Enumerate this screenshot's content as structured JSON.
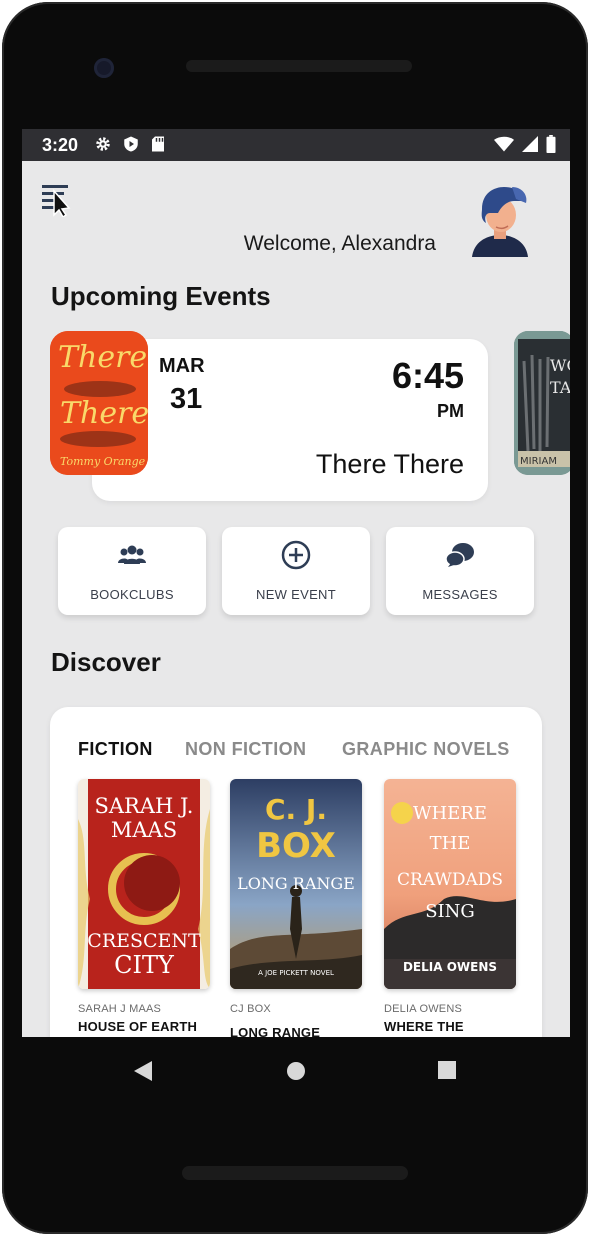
{
  "status_bar": {
    "time": "3:20",
    "left_icons": [
      "settings-icon",
      "shield-play-icon",
      "sd-card-icon"
    ],
    "right_icons": [
      "wifi-icon",
      "signal-icon",
      "battery-icon"
    ]
  },
  "header": {
    "welcome": "Welcome, Alexandra"
  },
  "events": {
    "title": "Upcoming Events",
    "card": {
      "month": "MAR",
      "day": "31",
      "time": "6:45",
      "ampm": "PM",
      "book_title": "There There",
      "cover_text_line1": "There",
      "cover_text_line2": "There",
      "cover_author": "Tommy Orange"
    },
    "next_cover_text": "WOMEN TALKING",
    "next_cover_author": "MIRIAM"
  },
  "actions": [
    {
      "label": "BOOKCLUBS",
      "icon": "people-icon"
    },
    {
      "label": "NEW EVENT",
      "icon": "plus-circle-icon"
    },
    {
      "label": "MESSAGES",
      "icon": "chat-bubbles-icon"
    }
  ],
  "discover": {
    "title": "Discover",
    "tabs": [
      "FICTION",
      "NON FICTION",
      "GRAPHIC NOVELS"
    ],
    "active_tab": "FICTION",
    "books": [
      {
        "author": "SARAH J MAAS",
        "title": "HOUSE OF EARTH",
        "cover_lines": [
          "SARAH J.",
          "MAAS",
          "CRESCENT",
          "CITY"
        ]
      },
      {
        "author": "CJ BOX",
        "title": "LONG RANGE",
        "cover_lines": [
          "C. J.",
          "BOX",
          "LONG RANGE",
          "A JOE PICKETT NOVEL"
        ]
      },
      {
        "author": "DELIA OWENS",
        "title": "WHERE THE",
        "cover_lines": [
          "WHERE",
          "THE",
          "CRAWDADS",
          "SING",
          "DELIA OWENS"
        ]
      }
    ]
  },
  "colors": {
    "screen_bg": "#e8e8e9",
    "accent_icon": "#2e3d55",
    "active_tab": "#111111",
    "inactive_tab": "#8a8a8a"
  }
}
